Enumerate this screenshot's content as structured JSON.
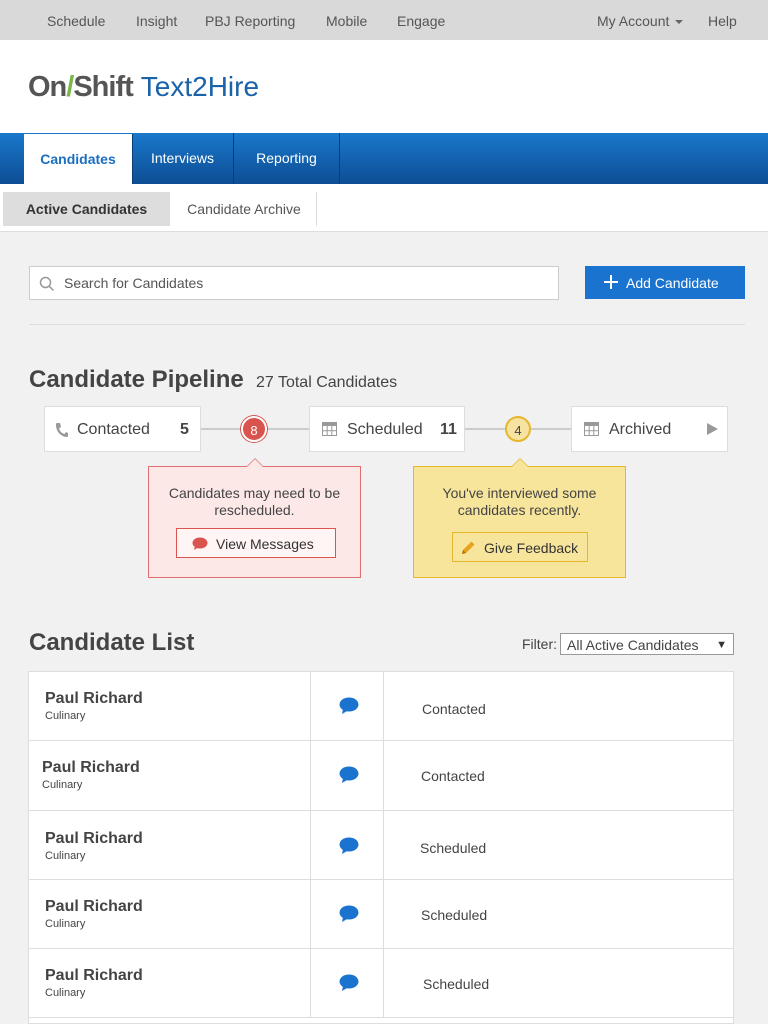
{
  "top_nav": {
    "items": [
      "Schedule",
      "Insight",
      "PBJ Reporting",
      "Mobile",
      "Engage"
    ],
    "account": "My Account",
    "help": "Help"
  },
  "header": {
    "logo_part1": "On",
    "logo_part2": "Shift",
    "product": "Text2Hire"
  },
  "main_nav": {
    "tabs": [
      "Candidates",
      "Interviews",
      "Reporting"
    ],
    "active": "Candidates"
  },
  "sub_nav": {
    "tabs": [
      "Active Candidates",
      "Candidate Archive"
    ],
    "active": "Active Candidates"
  },
  "search": {
    "placeholder": "Search for Candidates"
  },
  "add_button": "Add Candidate",
  "pipeline": {
    "title": "Candidate Pipeline",
    "total": "27 Total Candidates",
    "stages": [
      {
        "label": "Contacted",
        "count": "5",
        "icon": "phone-icon"
      },
      {
        "label": "Scheduled",
        "count": "11",
        "icon": "calendar-icon"
      },
      {
        "label": "Archived",
        "count": "",
        "icon": "calendar-icon"
      }
    ],
    "alerts": [
      {
        "count": "8",
        "message": "Candidates may need to be rescheduled.",
        "button": "View Messages",
        "color": "#d9534f"
      },
      {
        "count": "4",
        "message": "You've interviewed some candidates recently.",
        "button": "Give Feedback",
        "color": "#e6b62c"
      }
    ]
  },
  "candidate_list": {
    "title": "Candidate List",
    "filter_label": "Filter:",
    "filter_value": "All Active Candidates",
    "rows": [
      {
        "name": "Paul Richard",
        "dept": "Culinary",
        "status": "Contacted"
      },
      {
        "name": "Paul Richard",
        "dept": "Culinary",
        "status": "Contacted"
      },
      {
        "name": "Paul Richard",
        "dept": "Culinary",
        "status": "Scheduled"
      },
      {
        "name": "Paul Richard",
        "dept": "Culinary",
        "status": "Scheduled"
      },
      {
        "name": "Paul Richard",
        "dept": "Culinary",
        "status": "Scheduled"
      }
    ]
  },
  "colors": {
    "brand_blue": "#1a73cf",
    "logo_green": "#7ab648",
    "chat_blue": "#1a73cf"
  }
}
